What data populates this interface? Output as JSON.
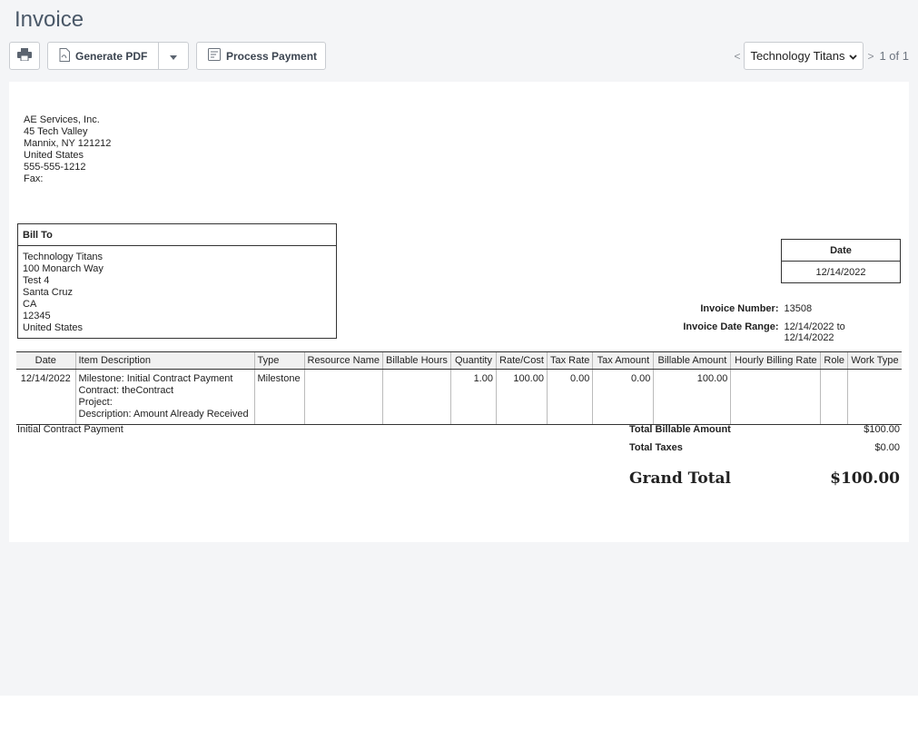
{
  "page": {
    "title": "Invoice"
  },
  "toolbar": {
    "print_icon": "printer-icon",
    "generate_pdf_label": "Generate PDF",
    "pdf_icon": "pdf-document-icon",
    "dropdown_icon": "caret-down-icon",
    "process_payment_label": "Process Payment",
    "payment_icon": "payment-form-icon"
  },
  "pager": {
    "prev": "<",
    "next": ">",
    "selected_client": "Technology Titans",
    "count": "1 of 1"
  },
  "company": {
    "lines": [
      "AE Services, Inc.",
      "45 Tech Valley",
      "Mannix, NY 121212",
      "United States",
      "555-555-1212",
      "Fax:"
    ]
  },
  "bill_to": {
    "heading": "Bill To",
    "lines": [
      "Technology Titans",
      "100 Monarch Way",
      "Test 4",
      "Santa Cruz",
      "CA",
      "12345",
      "United States"
    ]
  },
  "date_box": {
    "heading": "Date",
    "value": "12/14/2022"
  },
  "invoice_meta": {
    "number_label": "Invoice Number:",
    "number_value": "13508",
    "range_label": "Invoice Date Range:",
    "range_value": "12/14/2022 to 12/14/2022"
  },
  "table": {
    "columns": [
      "Date",
      "Item Description",
      "Type",
      "Resource Name",
      "Billable Hours",
      "Quantity",
      "Rate/Cost",
      "Tax Rate",
      "Tax Amount",
      "Billable Amount",
      "Hourly Billing Rate",
      "Role",
      "Work Type"
    ],
    "rows": [
      {
        "date": "12/14/2022",
        "description": [
          "Milestone: Initial Contract Payment",
          "Contract: theContract",
          "Project:",
          "Description: Amount Already Received"
        ],
        "type": "Milestone",
        "resource_name": "",
        "billable_hours": "",
        "quantity": "1.00",
        "rate_cost": "100.00",
        "tax_rate": "0.00",
        "tax_amount": "0.00",
        "billable_amount": "100.00",
        "hourly_billing_rate": "",
        "role": "",
        "work_type": ""
      }
    ]
  },
  "footer_note": "Initial Contract Payment",
  "totals": {
    "billable_label": "Total Billable Amount",
    "billable_value": "$100.00",
    "taxes_label": "Total Taxes",
    "taxes_value": "$0.00",
    "grand_label": "Grand Total",
    "grand_value": "$100.00"
  }
}
